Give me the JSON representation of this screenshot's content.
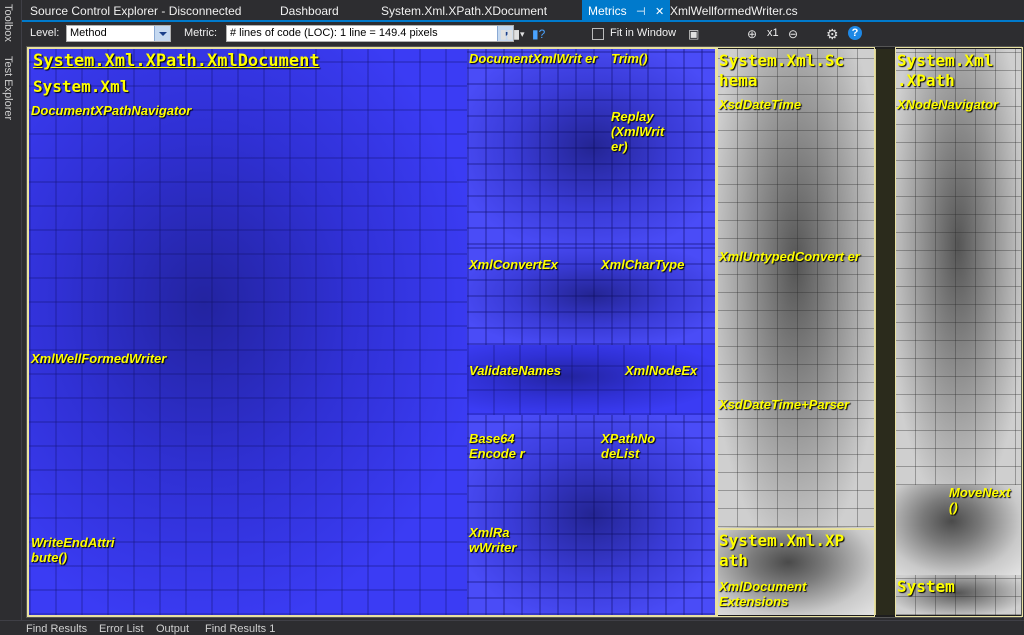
{
  "siderail": {
    "toolbox": "Toolbox",
    "test_explorer": "Test Explorer"
  },
  "tabs": [
    {
      "label": "Source Control Explorer - Disconnected"
    },
    {
      "label": "Dashboard"
    },
    {
      "label": "System.Xml.XPath.XDocument"
    },
    {
      "label": "Metrics",
      "active": true
    },
    {
      "label": "XmlWellformedWriter.cs"
    }
  ],
  "toolbar": {
    "level_label": "Level:",
    "level_value": "Method",
    "metric_label": "Metric:",
    "metric_value": "# lines of code (LOC):  1 line = 149.4 pixels",
    "fit_label": "Fit in Window",
    "zoom_value": "x1",
    "icons": [
      "bar-chart-icon",
      "chevron-down-icon",
      "bar-chart-help-icon",
      "fit-window-icon",
      "camera-icon",
      "zoom-in-icon",
      "zoom-out-icon",
      "settings-icon",
      "help-icon"
    ]
  },
  "treemap": {
    "root_namespace": "System.Xml.XPath.XmlDocument",
    "sub_namespace": "System.Xml",
    "labels": {
      "doc_xpath_nav": "DocumentXPathNavigator",
      "well_formed": "XmlWellFormedWriter",
      "write_end": "WriteEndAttri bute()",
      "doc_xml_writer": "DocumentXmlWrit er",
      "trim": "Trim()",
      "replay": "Replay (XmlWrit er)",
      "convert_ex": "XmlConvertEx",
      "char_type": "XmlCharType",
      "validate_names": "ValidateNames",
      "node_ex": "XmlNodeEx",
      "base64": "Base64 Encode r",
      "xpath_nodelist": "XPathNo deList",
      "raw_writer": "XmlRa wWriter",
      "ns_schema": "System.Xml.Sc hema",
      "xsd_datetime": "XsdDateTime",
      "untyped_convert": "XmlUntypedConvert er",
      "xsd_parser": "XsdDateTime+Parser",
      "ns_xpath_bottom": "System.Xml.XP ath",
      "doc_extensions": "XmlDocument Extensions",
      "ns_xpath_right": "System.Xml .XPath",
      "xnode_nav": "XNodeNavigator",
      "move_next": "MoveNext ()",
      "ns_system": "System"
    }
  },
  "bottom_tabs": [
    "Find Results",
    "Error List",
    "Output",
    "Find Results 1"
  ],
  "colors": {
    "accent": "#007acc",
    "label": "#ffff00",
    "blue_cells": "#3b3cf4"
  }
}
